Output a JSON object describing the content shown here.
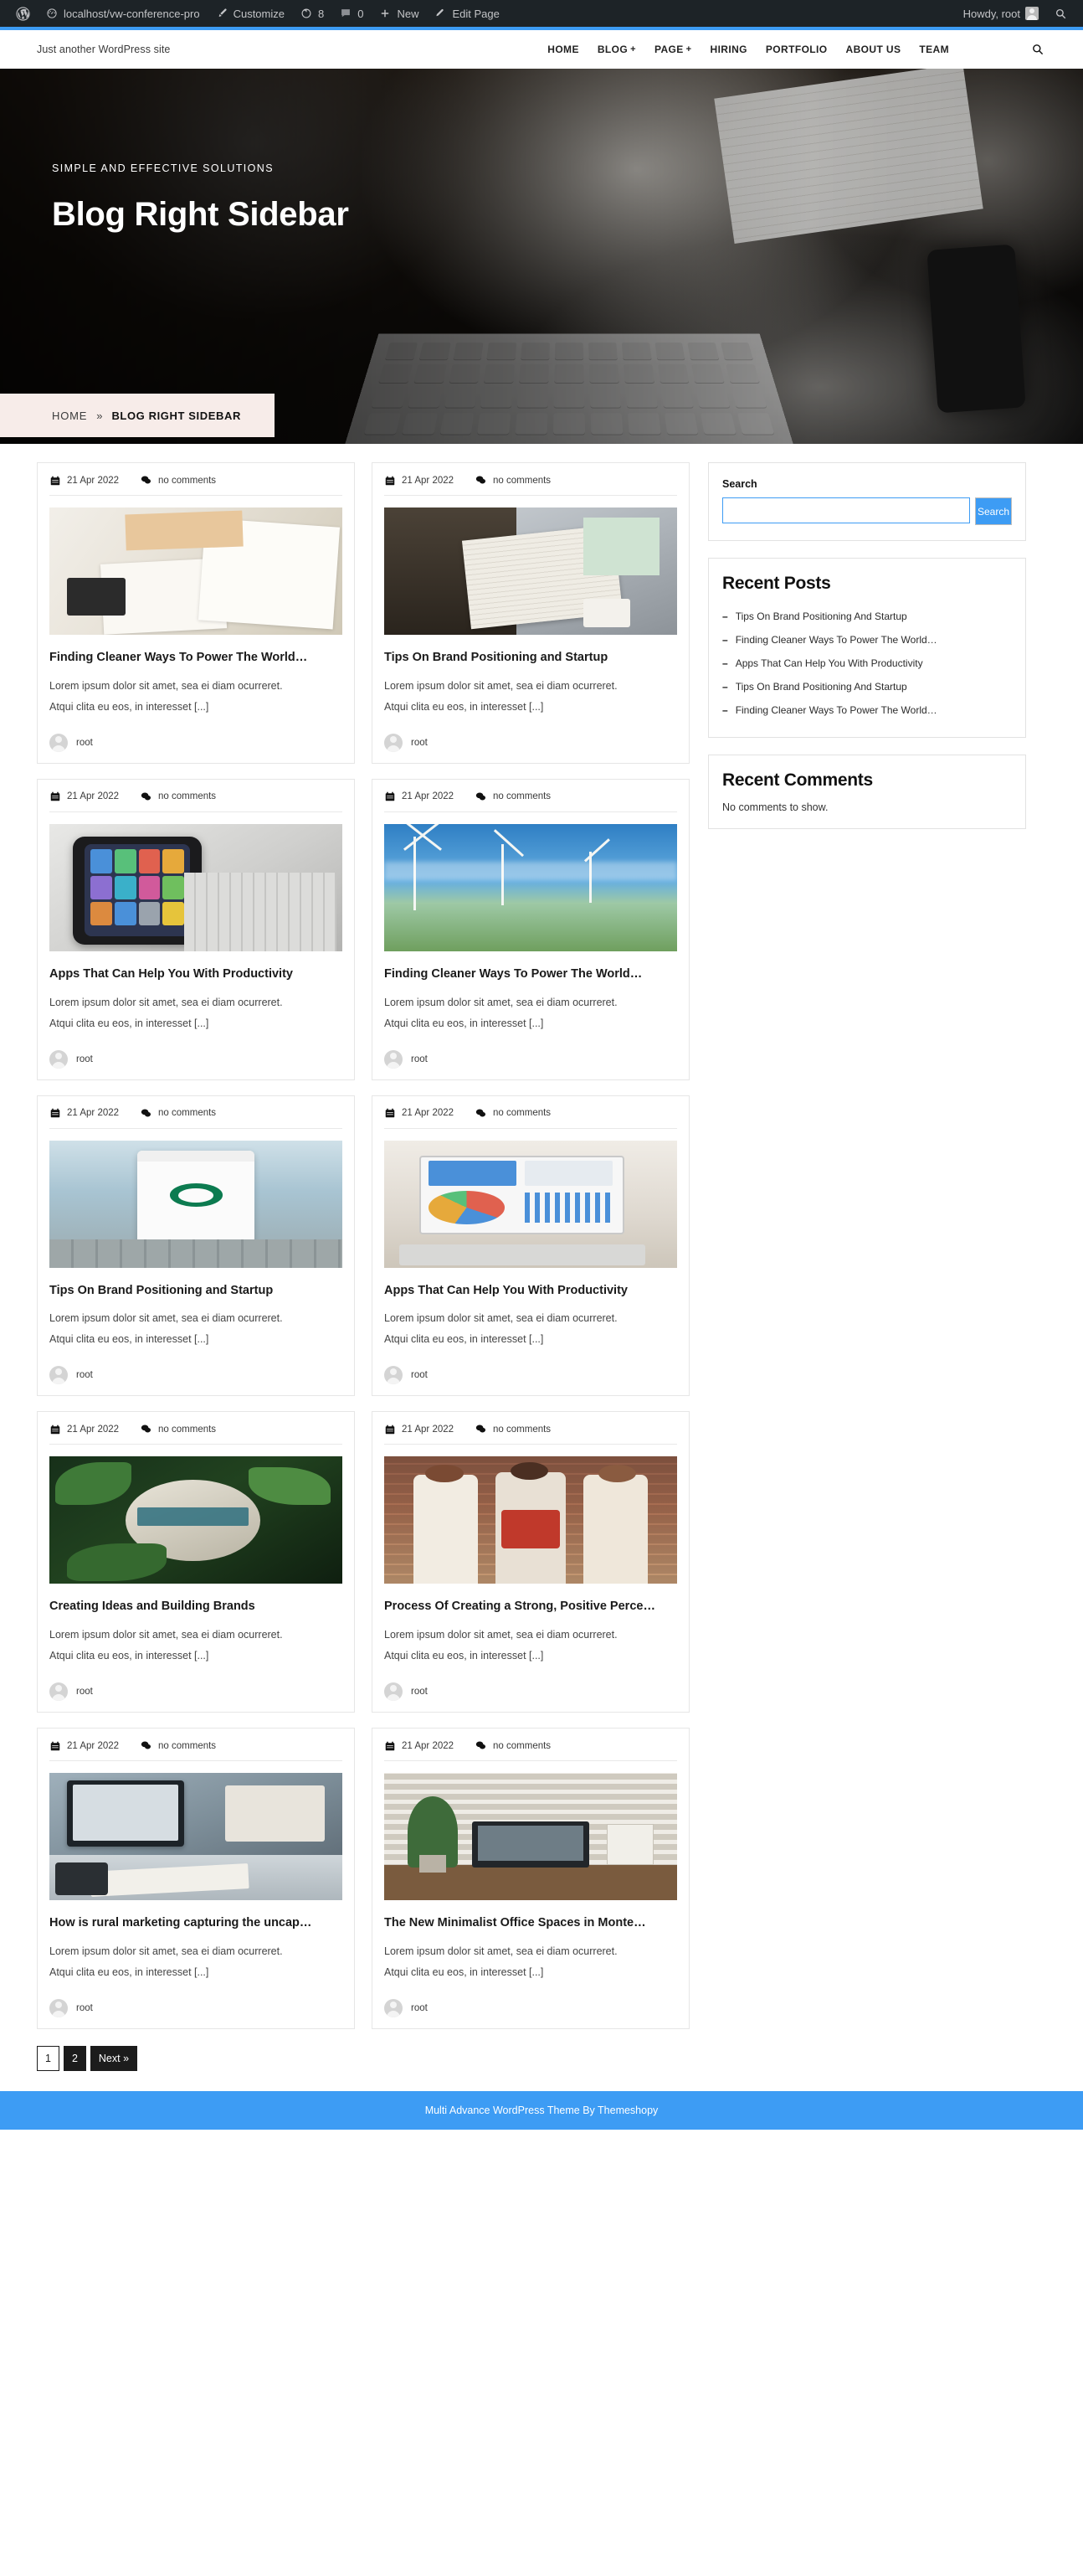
{
  "adminbar": {
    "wp_logo": "wordpress-logo-icon",
    "site_name": "localhost/vw-conference-pro",
    "customize": "Customize",
    "updates_count": "8",
    "comments_count": "0",
    "new": "New",
    "edit_page": "Edit Page",
    "howdy": "Howdy, root"
  },
  "header": {
    "tagline": "Just another WordPress site",
    "nav": [
      {
        "label": "HOME",
        "has_submenu": false
      },
      {
        "label": "BLOG",
        "has_submenu": true
      },
      {
        "label": "PAGE",
        "has_submenu": true
      },
      {
        "label": "HIRING",
        "has_submenu": false
      },
      {
        "label": "PORTFOLIO",
        "has_submenu": false
      },
      {
        "label": "ABOUT US",
        "has_submenu": false
      },
      {
        "label": "TEAM",
        "has_submenu": false
      }
    ],
    "submenu_marker": "+"
  },
  "hero": {
    "subtitle": "SIMPLE AND EFFECTIVE SOLUTIONS",
    "title": "Blog Right Sidebar",
    "breadcrumb_home": "HOME",
    "breadcrumb_separator": "»",
    "breadcrumb_current": "BLOG RIGHT SIDEBAR"
  },
  "posts": {
    "meta_date": "21 Apr 2022",
    "meta_comments": "no comments",
    "excerpt_line1": "Lorem ipsum dolor sit amet, sea ei diam ocurreret.",
    "excerpt_line2": "Atqui clita eu eos, in interesset [...]",
    "author": "root",
    "items": [
      {
        "title": "Finding Cleaner Ways To Power The World…",
        "thumb": "tax-documents-calculator-photo"
      },
      {
        "title": "Tips On Brand Positioning and Startup",
        "thumb": "person-reading-business-newspaper-photo"
      },
      {
        "title": "Apps That Can Help You With Productivity",
        "thumb": "hand-holding-smartphone-apps-photo"
      },
      {
        "title": "Finding Cleaner Ways To Power The World…",
        "thumb": "wind-turbines-field-photo"
      },
      {
        "title": "Tips On Brand Positioning and Startup",
        "thumb": "starbucks-coffee-cup-photo"
      },
      {
        "title": "Apps That Can Help You With Productivity",
        "thumb": "laptop-with-charts-photo"
      },
      {
        "title": "Creating Ideas and Building Brands",
        "thumb": "spalding-ball-in-leaves-photo"
      },
      {
        "title": "Process Of Creating a Strong, Positive Perce…",
        "thumb": "three-women-walking-photo"
      },
      {
        "title": "How is rural marketing capturing the uncap…",
        "thumb": "person-working-at-desk-photo"
      },
      {
        "title": "The New Minimalist Office Spaces in Monte…",
        "thumb": "minimal-office-desk-plant-photo"
      }
    ]
  },
  "sidebar": {
    "search": {
      "label": "Search",
      "value": "",
      "placeholder": "",
      "button": "Search"
    },
    "recent_posts": {
      "title": "Recent Posts",
      "bullet": "–",
      "items": [
        "Tips On Brand Positioning And Startup",
        "Finding Cleaner Ways To Power The World…",
        "Apps That Can Help You With Productivity",
        "Tips On Brand Positioning And Startup",
        "Finding Cleaner Ways To Power The World…"
      ]
    },
    "recent_comments": {
      "title": "Recent Comments",
      "empty": "No comments to show."
    }
  },
  "pagination": {
    "pages": [
      "1",
      "2"
    ],
    "current": "1",
    "next": "Next »"
  },
  "footer": {
    "text": "Multi Advance WordPress Theme By Themeshopy"
  },
  "colors": {
    "accent": "#3d9cf4",
    "adminbar": "#1d2327",
    "breadcrumb_bg": "#f7ece9",
    "pagination_dark": "#1c1c1c"
  }
}
